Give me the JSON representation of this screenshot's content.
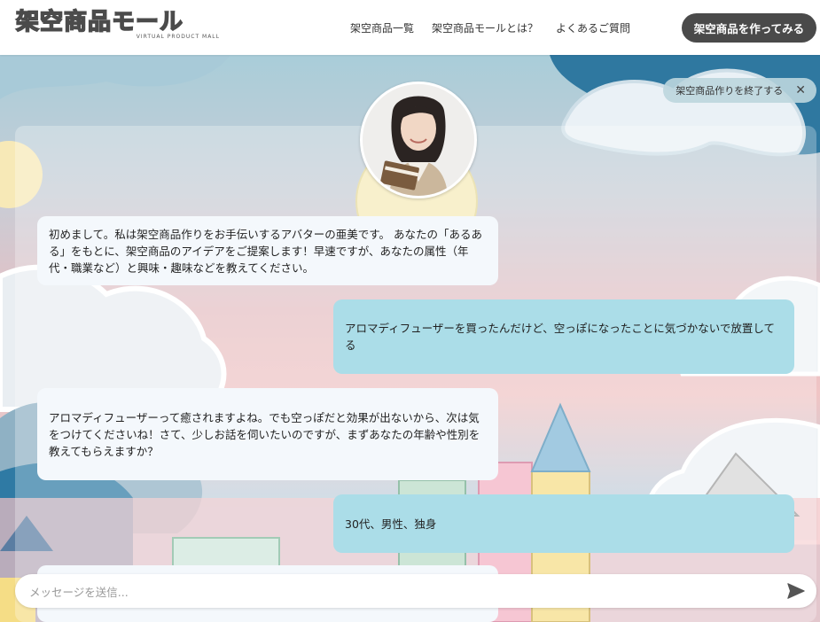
{
  "header": {
    "logo_text": "架空商品モール",
    "logo_sub": "VIRTUAL PRODUCT MALL",
    "nav": [
      "架空商品一覧",
      "架空商品モールとは？",
      "よくあるご質問"
    ],
    "cta_label": "架空商品を作ってみる"
  },
  "chat": {
    "end_label": "架空商品作りを終了する",
    "messages": [
      {
        "role": "bot",
        "text": "初めまして。私は架空商品作りをお手伝いするアバターの亜美です。 あなたの「あるある」をもとに、架空商品のアイデアをご提案します！早速ですが、あなたの属性（年代・職業など）と興味・趣味などを教えてください。"
      },
      {
        "role": "user",
        "text": "アロマディフューザーを買ったんだけど、空っぽになったことに気づかないで放置してる"
      },
      {
        "role": "bot",
        "text": "アロマディフューザーって癒されますよね。でも空っぽだと効果が出ないから、次は気をつけてくださいね！さて、少しお話を伺いたいのですが、まずあなたの年齢や性別を教えてもらえますか？"
      },
      {
        "role": "user",
        "text": "30代、男性、独身"
      },
      {
        "role": "bot",
        "text": ""
      }
    ],
    "input_placeholder": "メッセージを送信..."
  },
  "icons": {
    "close": "close-icon",
    "send": "send-icon"
  }
}
